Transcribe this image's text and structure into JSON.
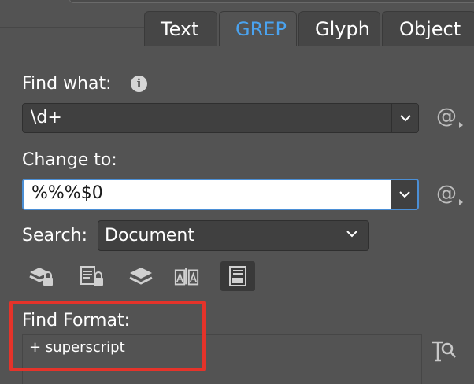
{
  "tabs": [
    {
      "label": "Text",
      "active": false
    },
    {
      "label": "GREP",
      "active": true
    },
    {
      "label": "Glyph",
      "active": false
    },
    {
      "label": "Object",
      "active": false
    }
  ],
  "find_what": {
    "label": "Find what:",
    "value": "\\d+",
    "info_icon": "info-icon"
  },
  "change_to": {
    "label": "Change to:",
    "value": "%%%$0"
  },
  "special_chars_button": "@",
  "search": {
    "label": "Search:",
    "value": "Document"
  },
  "option_icons": [
    "include-locked-layers-icon",
    "include-locked-stories-icon",
    "include-hidden-layers-icon",
    "include-master-pages-icon",
    "include-footnotes-icon"
  ],
  "find_format": {
    "label": "Find Format:",
    "value": "+ superscript",
    "icon": "specify-attributes-icon"
  },
  "colors": {
    "accent": "#4aa3f0",
    "highlight": "#e5332a",
    "panel": "#535353"
  }
}
